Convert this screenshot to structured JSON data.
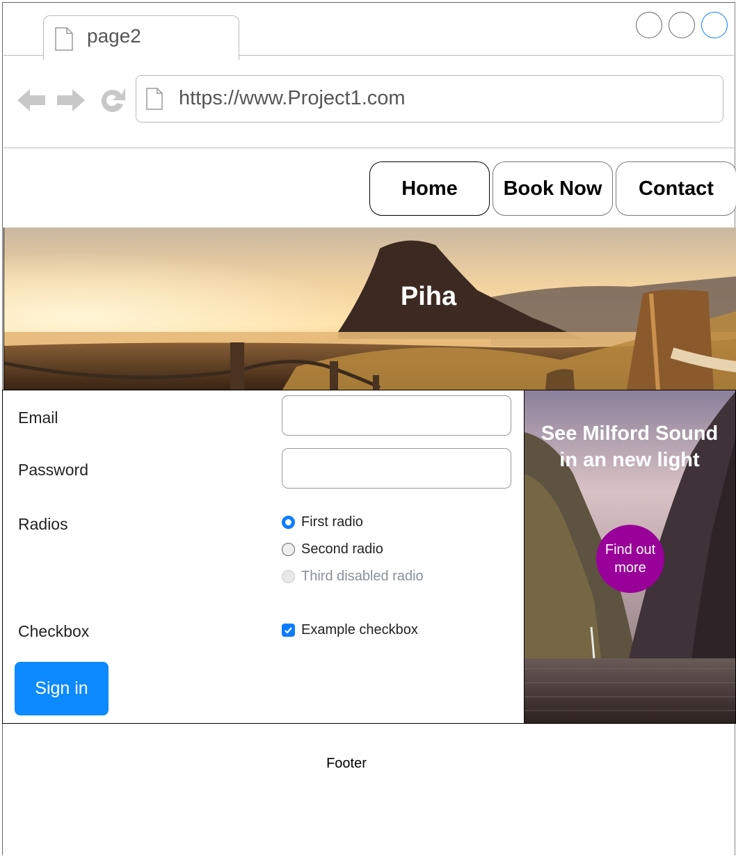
{
  "browser": {
    "tab_label": "page2",
    "url": "https://www.Project1.com"
  },
  "nav": {
    "home": "Home",
    "book_now": "Book Now",
    "contact": "Contact"
  },
  "hero": {
    "title": "Piha"
  },
  "form": {
    "email_label": "Email",
    "password_label": "Password",
    "radios_label": "Radios",
    "radios": [
      {
        "label": "First radio",
        "checked": true,
        "disabled": false
      },
      {
        "label": "Second radio",
        "checked": false,
        "disabled": false
      },
      {
        "label": "Third disabled radio",
        "checked": false,
        "disabled": true
      }
    ],
    "checkbox_label": "Checkbox",
    "checkbox_text": "Example checkbox",
    "checkbox_checked": true,
    "submit": "Sign in"
  },
  "promo": {
    "title": "See Milford Sound in an new light",
    "cta": "Find out more"
  },
  "footer": {
    "text": "Footer"
  },
  "colors": {
    "primary": "#0d8aff",
    "accent": "#990099",
    "window_button_active": "#0d7cff"
  }
}
